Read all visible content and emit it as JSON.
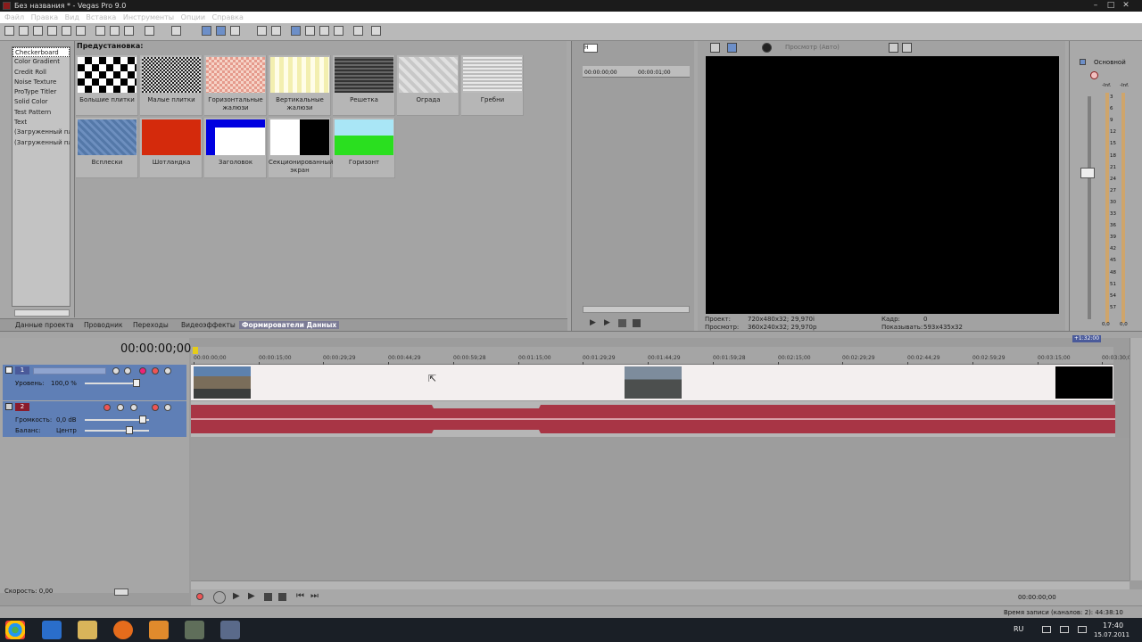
{
  "window": {
    "title": "Без названия * - Vegas Pro 9.0",
    "menu": [
      "Файл",
      "Правка",
      "Вид",
      "Вставка",
      "Инструменты",
      "Опции",
      "Справка"
    ]
  },
  "generators": {
    "items": [
      "Checkerboard",
      "Color Gradient",
      "Credit Roll",
      "Noise Texture",
      "ProType Titler",
      "Solid Color",
      "Test Pattern",
      "Text",
      "(Загруженный пл",
      "(Загруженный пл"
    ],
    "selected": 0,
    "presets_label": "Предустановка:",
    "presets": [
      {
        "label": "Большие плитки"
      },
      {
        "label": "Малые плитки"
      },
      {
        "label": "Горизонтальные жалюзи"
      },
      {
        "label": "Вертикальные жалюзи"
      },
      {
        "label": "Решетка"
      },
      {
        "label": "Ограда"
      },
      {
        "label": "Гребни"
      },
      {
        "label": "Всплески"
      },
      {
        "label": "Шотландка"
      },
      {
        "label": "Заголовок"
      },
      {
        "label": "Секционированный экран"
      },
      {
        "label": "Горизонт"
      }
    ]
  },
  "tabs": [
    "Данные проекта",
    "Проводник",
    "Переходы",
    "Видеоэффекты",
    "Формирователи Данных"
  ],
  "active_tab": 4,
  "trimmer": {
    "t0": "00:00:00;00",
    "t1": "00:00:01;00"
  },
  "preview": {
    "toolbar_label": "Просмотр (Авто)",
    "project_label": "Проект:",
    "project_value": "720x480x32; 29,970i",
    "preview_label": "Просмотр:",
    "preview_value": "360x240x32; 29,970p",
    "frame_label": "Кадр:",
    "frame_value": "0",
    "display_label": "Показывать:",
    "display_value": "593x435x32"
  },
  "mixer": {
    "title": "Основной",
    "top_values": [
      "-Inf.",
      "-Inf."
    ],
    "scale": [
      "3",
      "6",
      "9",
      "12",
      "15",
      "18",
      "21",
      "24",
      "27",
      "30",
      "33",
      "36",
      "39",
      "42",
      "45",
      "48",
      "51",
      "54",
      "57"
    ],
    "bottom_values": [
      "0,0",
      "0,0"
    ]
  },
  "timeline": {
    "timecode": "00:00:00;00",
    "end_badge": "+1:32:00",
    "ruler": [
      "00:00:00;00",
      "00:00:15;00",
      "00:00:29;29",
      "00:00:44;29",
      "00:00:59;28",
      "00:01:15;00",
      "00:01:29;29",
      "00:01:44;29",
      "00:01:59;28",
      "00:02:15;00",
      "00:02:29;29",
      "00:02:44;29",
      "00:02:59;29",
      "00:03:15;00",
      "00:03:30;00"
    ],
    "video_track": {
      "number": "1",
      "level_label": "Уровень:",
      "level_value": "100,0 %"
    },
    "audio_track": {
      "number": "2",
      "volume_label": "Громкость:",
      "volume_value": "0,0 dB",
      "pan_label": "Баланс:",
      "pan_value": "Центр"
    }
  },
  "transport": {
    "time": "00:00:00;00"
  },
  "status": {
    "speed_label": "Скорость: 0,00",
    "record_time": "Время записи (каналов: 2): 44:38:10"
  },
  "taskbar": {
    "lang": "RU",
    "time": "17:40",
    "date": "15.07.2011"
  }
}
